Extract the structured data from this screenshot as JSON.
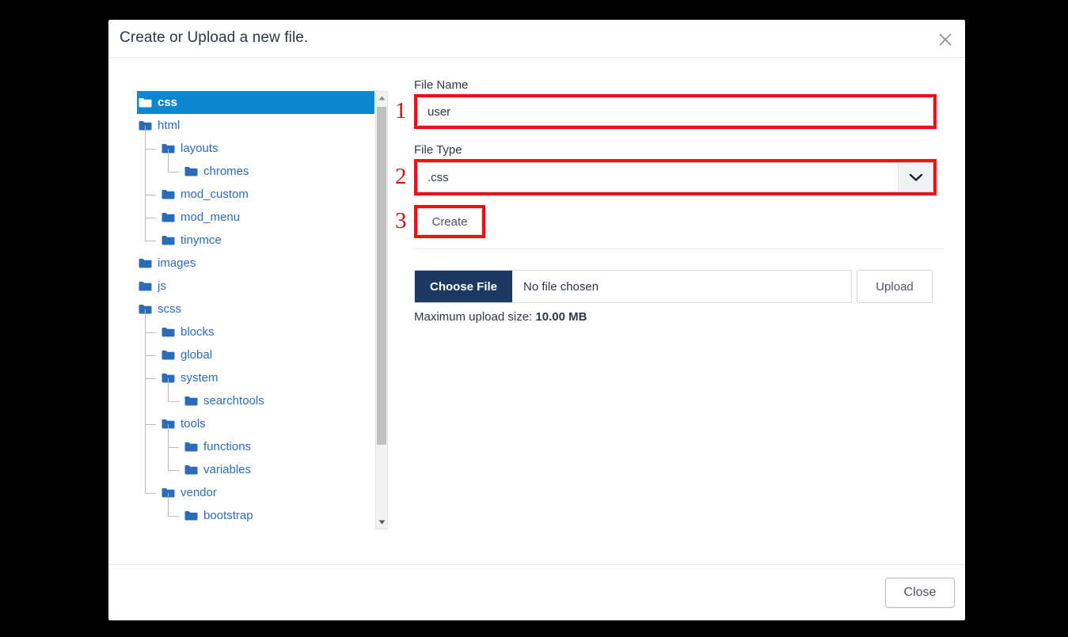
{
  "modal": {
    "title": "Create or Upload a new file.",
    "close_icon": "close-icon"
  },
  "tree": {
    "items": [
      {
        "label": "css",
        "depth": 0,
        "selected": true,
        "last": false
      },
      {
        "label": "html",
        "depth": 0,
        "selected": false,
        "last": false
      },
      {
        "label": "layouts",
        "depth": 1,
        "selected": false,
        "last": false
      },
      {
        "label": "chromes",
        "depth": 2,
        "selected": false,
        "last": true
      },
      {
        "label": "mod_custom",
        "depth": 1,
        "selected": false,
        "last": false
      },
      {
        "label": "mod_menu",
        "depth": 1,
        "selected": false,
        "last": false
      },
      {
        "label": "tinymce",
        "depth": 1,
        "selected": false,
        "last": true
      },
      {
        "label": "images",
        "depth": 0,
        "selected": false,
        "last": false
      },
      {
        "label": "js",
        "depth": 0,
        "selected": false,
        "last": false
      },
      {
        "label": "scss",
        "depth": 0,
        "selected": false,
        "last": false
      },
      {
        "label": "blocks",
        "depth": 1,
        "selected": false,
        "last": false
      },
      {
        "label": "global",
        "depth": 1,
        "selected": false,
        "last": false
      },
      {
        "label": "system",
        "depth": 1,
        "selected": false,
        "last": false
      },
      {
        "label": "searchtools",
        "depth": 2,
        "selected": false,
        "last": true
      },
      {
        "label": "tools",
        "depth": 1,
        "selected": false,
        "last": false
      },
      {
        "label": "functions",
        "depth": 2,
        "selected": false,
        "last": false
      },
      {
        "label": "variables",
        "depth": 2,
        "selected": false,
        "last": true
      },
      {
        "label": "vendor",
        "depth": 1,
        "selected": false,
        "last": true
      },
      {
        "label": "bootstrap",
        "depth": 2,
        "selected": false,
        "last": false
      }
    ],
    "scrollbar": {
      "up_icon": "triangle-up-icon",
      "down_icon": "triangle-down-icon"
    }
  },
  "form": {
    "file_name_label": "File Name",
    "file_name_value": "user",
    "file_name_placeholder": "",
    "file_type_label": "File Type",
    "file_type_value": ".css",
    "file_type_caret_icon": "chevron-down-icon",
    "create_label": "Create"
  },
  "upload": {
    "choose_file_label": "Choose File",
    "file_chosen_text": "No file chosen",
    "upload_label": "Upload",
    "max_size_prefix": "Maximum upload size: ",
    "max_size_value": "10.00 MB"
  },
  "footer": {
    "close_label": "Close"
  },
  "annotations": [
    {
      "number": "1"
    },
    {
      "number": "2"
    },
    {
      "number": "3"
    }
  ],
  "colors": {
    "selected_row": "#0c87d0",
    "folder_blue": "#2b6cb8",
    "annotation_red": "#ee1111",
    "choose_file_navy": "#1c3a61"
  }
}
